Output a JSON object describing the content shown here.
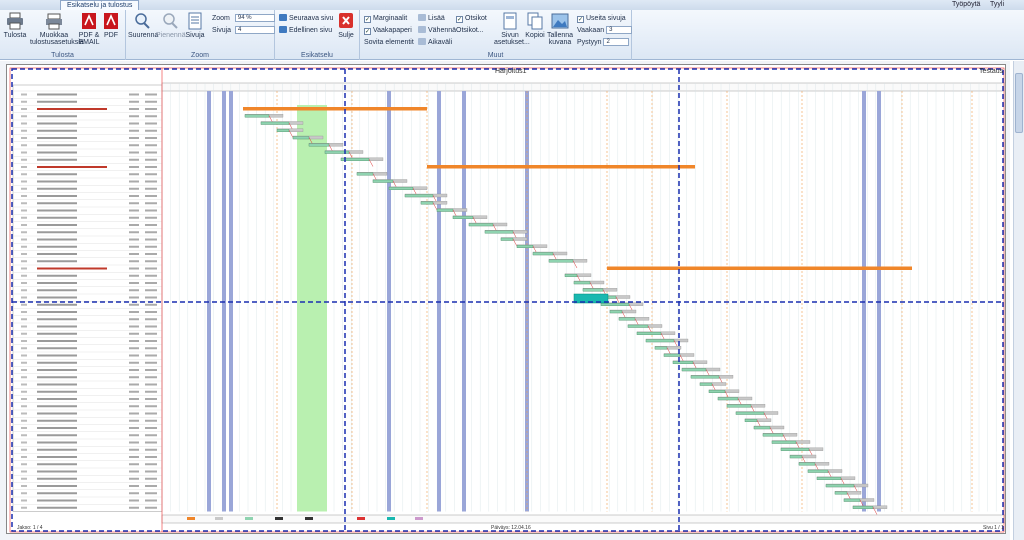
{
  "tab": {
    "label": "Esikatselu ja tulostus"
  },
  "top_right": {
    "desktop": "Työpöytä",
    "style": "Tyyli"
  },
  "ribbon": {
    "print_btn": "Tulosta",
    "edit_btn": "Muokkaa tulostusasetuksia",
    "pdf_email_btn": "PDF & EMAIL",
    "pdf_btn": "PDF",
    "group_print": "Tulosta",
    "enlarge_btn": "Suurenna",
    "shrink_btn": "Pienennä",
    "page_btn": "Sivuja",
    "zoom_label": "Zoom",
    "zoom_value": "94 %",
    "pages_label": "Sivuja",
    "pages_value": "4",
    "group_zoom": "Zoom",
    "next_page": "Seuraava sivu",
    "prev_page": "Edellinen sivu",
    "close_btn": "Sulje",
    "group_preview": "Esikatselu",
    "margins": "Marginaalit",
    "landscape": "Vaakapaperi",
    "fit_elements": "Sovita elementit",
    "add": "Lisää",
    "reduce": "Vähennä",
    "timeline": "Aikaväli",
    "headers": "Otsikot",
    "headers2": "Otsikot...",
    "page_settings": "Sivun asetukset...",
    "copies": "Kopioi",
    "save_image": "Tallenna kuvana",
    "multiple_pages": "Useita sivuja",
    "horizontal_label": "Vaakaan",
    "horizontal_value": "3",
    "vertical_label": "Pystyyn",
    "vertical_value": "2",
    "group_other": "Muut"
  },
  "preview": {
    "title_main": "Harjoitus1",
    "title_right": "Testaus",
    "footer_left": "Jakso: 1 / 4",
    "footer_center": "Päiväys: 12.04.16",
    "footer_right": "Sivu 1 / 1"
  },
  "colors": {
    "summary": "#f0862a",
    "task": "#8fd3b0",
    "baseline": "#c8c8c8",
    "weekend": "#9aa6d8",
    "milestone": "#19b8b0",
    "pagebreak": "#1a2fb0",
    "grid": "#d7e2e6"
  },
  "icons": [
    "printer-icon",
    "edit-settings-icon",
    "pdf-email-icon",
    "pdf-icon",
    "zoom-in-icon",
    "zoom-out-icon",
    "pages-icon",
    "next-page-icon",
    "prev-page-icon",
    "close-icon",
    "page-settings-icon",
    "copy-icon",
    "save-image-icon"
  ]
}
